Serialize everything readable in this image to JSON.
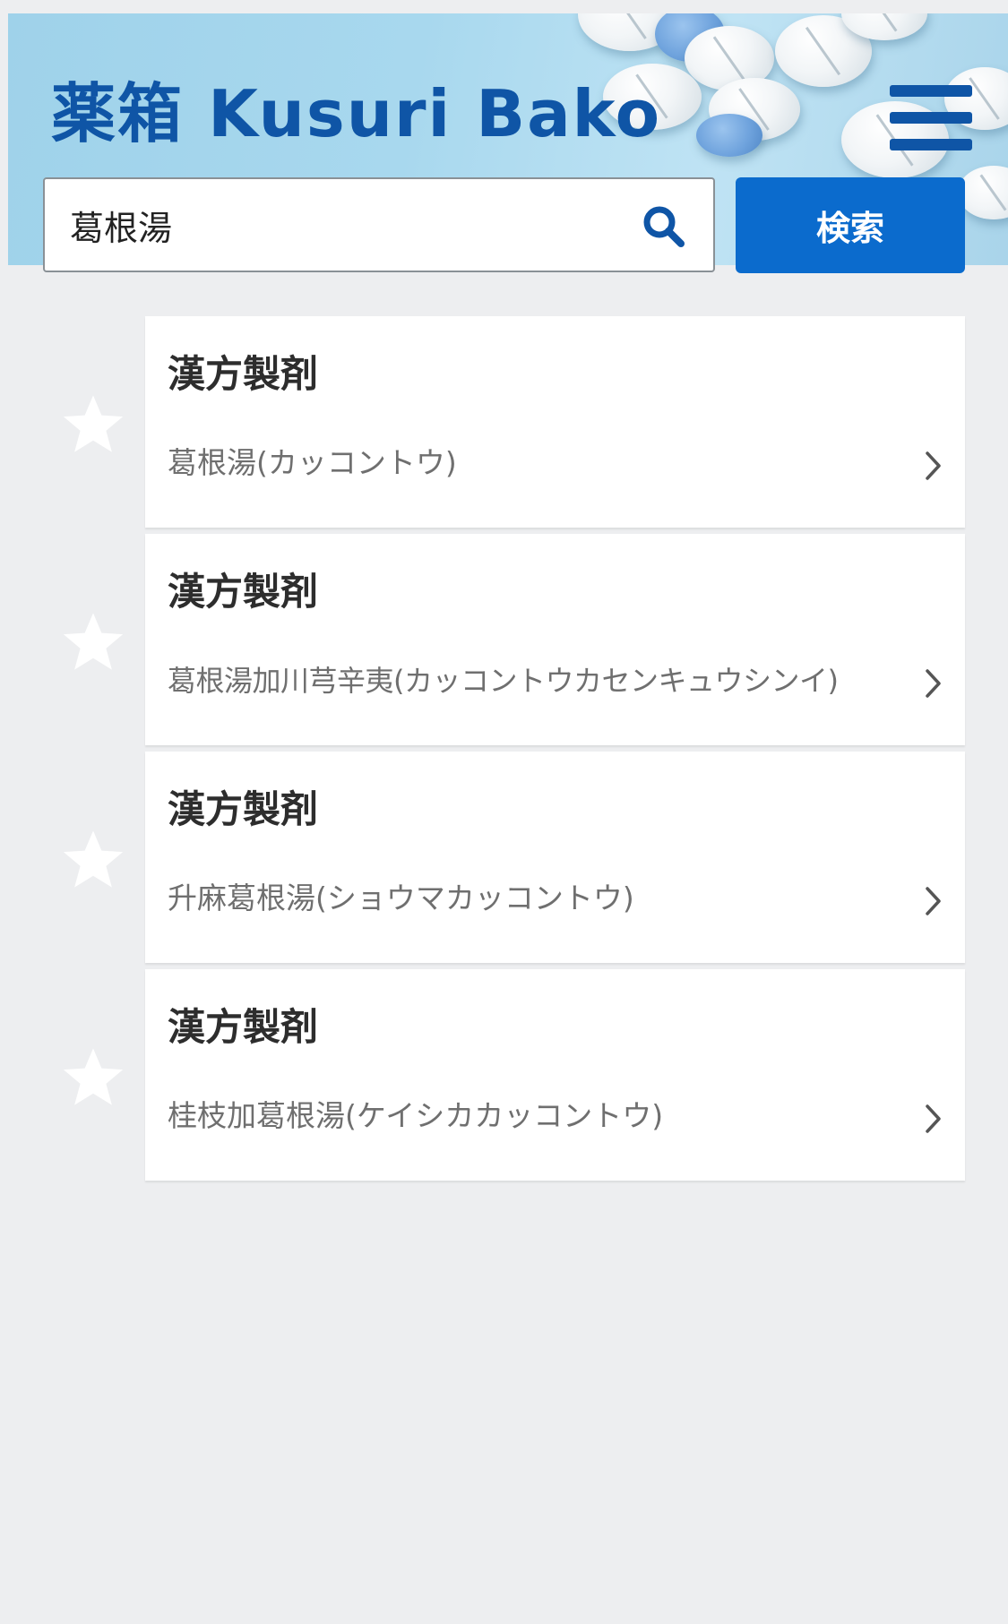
{
  "header": {
    "brand": "薬箱 Kusuri Bako",
    "menu_icon": "hamburger-menu-icon"
  },
  "search": {
    "value": "葛根湯",
    "placeholder": "",
    "icon": "search-icon",
    "button_label": "検索"
  },
  "results": [
    {
      "category": "漢方製剤",
      "name": "葛根湯(カッコントウ)",
      "favorite_icon": "star-icon",
      "arrow_icon": "chevron-right-icon"
    },
    {
      "category": "漢方製剤",
      "name": "葛根湯加川芎辛夷(カッコントウカセンキュウシンイ)",
      "favorite_icon": "star-icon",
      "arrow_icon": "chevron-right-icon"
    },
    {
      "category": "漢方製剤",
      "name": "升麻葛根湯(ショウマカッコントウ)",
      "favorite_icon": "star-icon",
      "arrow_icon": "chevron-right-icon"
    },
    {
      "category": "漢方製剤",
      "name": "桂枝加葛根湯(ケイシカカッコントウ)",
      "favorite_icon": "star-icon",
      "arrow_icon": "chevron-right-icon"
    }
  ],
  "colors": {
    "brand": "#0f55a6",
    "search_button": "#0b6bcd",
    "page_background": "#edeef0",
    "card_background": "#ffffff",
    "star": "#ffffff"
  }
}
